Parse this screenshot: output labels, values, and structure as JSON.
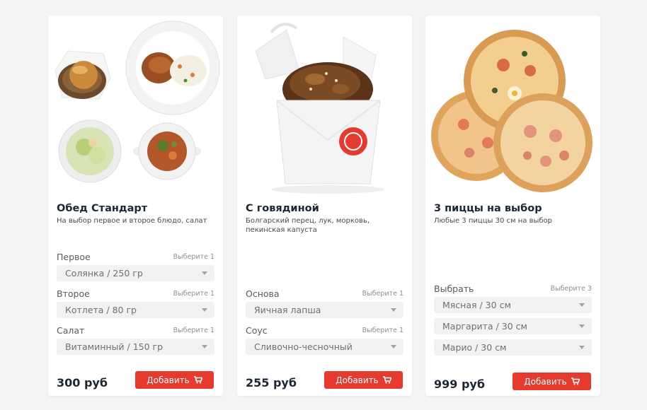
{
  "cards": [
    {
      "title": "Обед Стандарт",
      "description": "На выбор первое и второе блюдо, салат",
      "options": [
        {
          "label": "Первое",
          "hint": "Выберите 1",
          "value": "Солянка / 250 гр"
        },
        {
          "label": "Второе",
          "hint": "Выберите 1",
          "value": "Котлета / 80 гр"
        },
        {
          "label": "Салат",
          "hint": "Выберите 1",
          "value": "Витаминный / 150 гр"
        }
      ],
      "price": "300 руб",
      "button": "Добавить"
    },
    {
      "title": "С говядиной",
      "description": "Болгарский перец, лук, морковь, пекинская капуста",
      "options": [
        {
          "label": "Основа",
          "hint": "Выберите 1",
          "value": "Яичная лапша"
        },
        {
          "label": "Соус",
          "hint": "Выберите 1",
          "value": "Сливочно-чесночный"
        }
      ],
      "price": "255 руб",
      "button": "Добавить"
    },
    {
      "title": "3 пиццы на выбор",
      "description": "Любые 3 пиццы 30 см на выбор",
      "options_label": "Выбрать",
      "options_hint": "Выберите 3",
      "selects": [
        "Мясная / 30 см",
        "Маргарита / 30 см",
        "Марио / 30 см"
      ],
      "price": "999 руб",
      "button": "Добавить"
    }
  ],
  "colors": {
    "accent": "#e63a2f",
    "text": "#1d2733",
    "background": "#f4f4f4",
    "select_bg": "#f2f2f2"
  },
  "icons": {
    "cart": "shopping-cart-icon",
    "dropdown": "chevron-down-icon"
  }
}
